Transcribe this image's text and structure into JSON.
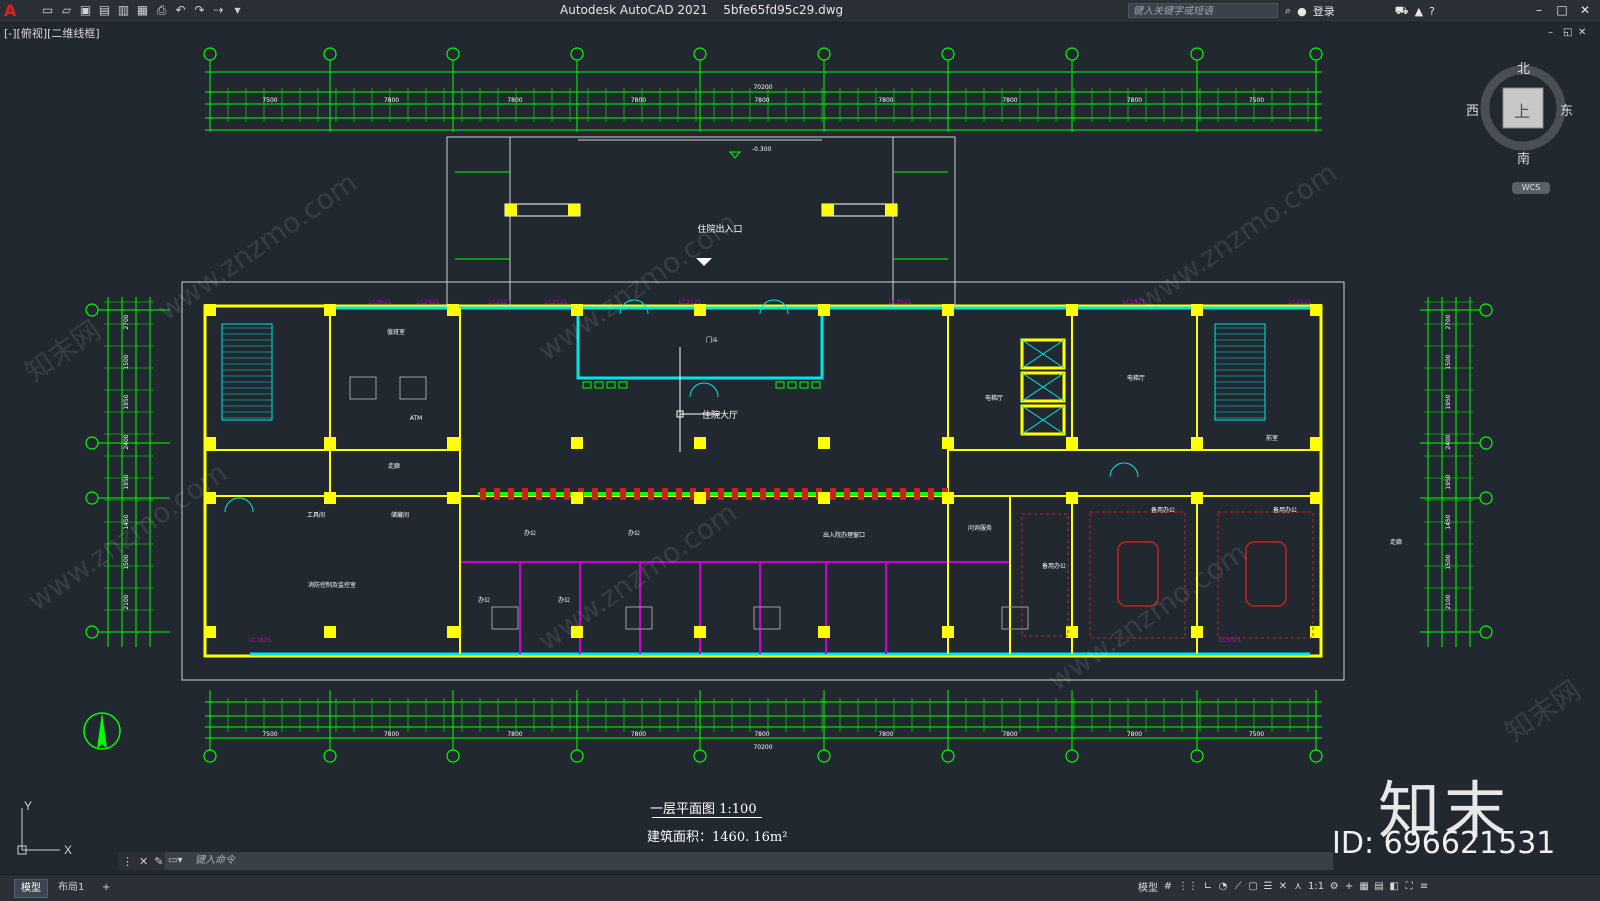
{
  "app": {
    "title": "Autodesk AutoCAD 2021",
    "filename": "5bfe65fd95c29.dwg",
    "search_placeholder": "键入关键字或短语",
    "login_label": "登录"
  },
  "viewport": {
    "label": "[-][俯视][二维线框]"
  },
  "viewcube": {
    "north": "北",
    "south": "南",
    "east": "东",
    "west": "西",
    "top_face": "上",
    "wcs": "WCS"
  },
  "drawing": {
    "overall_dimension": "70200",
    "top_bays": [
      "7500",
      "7800",
      "7800",
      "7800",
      "7800",
      "7800",
      "7800",
      "7800",
      "7500"
    ],
    "left_bays": [
      "2700",
      "1500",
      "1950",
      "2400",
      "1950",
      "1450",
      "1500",
      "2100"
    ],
    "axis_bubbles_count": 10,
    "rooms": {
      "entrance": "住院出入口",
      "hall": "住院大厅",
      "gate_room": "门斗",
      "elevator_hall": "电梯厅",
      "atm": "ATM",
      "duty_room": "值班室",
      "office": "办公",
      "standby_office": "备用办公",
      "fire_control": "消防控制及监控室",
      "corridor": "走廊",
      "stair_front": "前室",
      "tool_room": "工具间",
      "storage": "储藏间",
      "admission": "出入院办理窗口",
      "inquiry": "问询服务"
    },
    "elevation_mark": "-0.300",
    "window_tags": [
      "LC3021",
      "LC2421",
      "LC2121",
      "LC2121",
      "LC2121",
      "LC3021",
      "LC1821",
      "LC2121",
      "LC1821",
      "LC3021"
    ]
  },
  "caption": {
    "title": "一层平面图  1:100",
    "area": "建筑面积：1460. 16m²"
  },
  "watermark": {
    "brand": "知末",
    "id": "ID: 696621531",
    "site": "www.znzmo.com",
    "site_cn": "知末网"
  },
  "command": {
    "placeholder": "键入命令"
  },
  "status": {
    "tab_model": "模型",
    "tab_layout": "布局1",
    "add_tab": "+",
    "model_label": "模型",
    "scale": "1:1"
  },
  "colors": {
    "background": "#212830",
    "wall_yellow": "#ffff00",
    "dimension_green": "#00ff00",
    "window_cyan": "#00e5e5",
    "partition_magenta": "#cc00cc",
    "furniture_red": "#cc2020",
    "text_white": "#ffffff"
  }
}
